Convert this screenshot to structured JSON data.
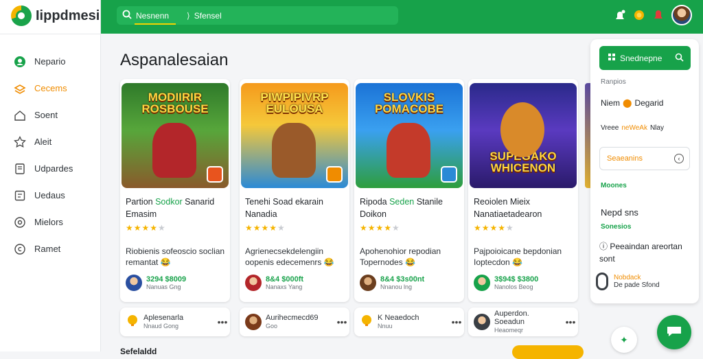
{
  "app": {
    "name": "Iippdmesi"
  },
  "sidebar": {
    "items": [
      {
        "label": "Nepario",
        "icon": "profile-icon"
      },
      {
        "label": "Cecems",
        "icon": "layers-icon",
        "active": true
      },
      {
        "label": "Soent",
        "icon": "home-icon"
      },
      {
        "label": "Aleit",
        "icon": "star-icon"
      },
      {
        "label": "Udpardes",
        "icon": "folder-icon"
      },
      {
        "label": "Uedaus",
        "icon": "list-icon"
      },
      {
        "label": "Mielors",
        "icon": "settings-icon"
      },
      {
        "label": "Ramet",
        "icon": "copyright-icon"
      }
    ]
  },
  "search": {
    "query": "Nesnenn",
    "secondary": "Sfensel"
  },
  "main": {
    "title": "Aspanalesaian"
  },
  "cards": [
    {
      "thumb_title": "MODIIRIR ROSBOUSE",
      "title_a": "Partion ",
      "title_hl": "Sodkor",
      "title_b": " Sanarid Emasim",
      "rating": 4,
      "desc": "Riobienis sofeoscio soclian remantat 😂",
      "price": "3294 $8009",
      "price_sub": "Nanuas Gng"
    },
    {
      "thumb_title": "PIWPIPIVRP EULOUSA",
      "title_a": "Tenehi Soad ekarain Nanadia",
      "title_hl": "",
      "title_b": "",
      "rating": 4,
      "desc": "Agrienecsekdelengiin oopenis edecemenrs 😂",
      "price": "8&4 $000ft",
      "price_sub": "Nanaxs Yang"
    },
    {
      "thumb_title": "SLOVKIS POMACOBE",
      "title_a": "Ripoda ",
      "title_hl": "Seden",
      "title_b": " Stanile Doikon",
      "rating": 4,
      "desc": "Apohenohior repodian Topernodes 😂",
      "price": "8&4 $3s00nt",
      "price_sub": "Nnanou lng"
    },
    {
      "thumb_title": "SUPEGAKO WHICENON",
      "title_a": "Reoiolen Mieix Nanatiaetadearon",
      "title_hl": "",
      "title_b": "",
      "rating": 4,
      "desc": "Pajpoioicane bepdonian Ioptecdon 😂",
      "price": "3$94$ $3800",
      "price_sub": "Nanolos Beog"
    }
  ],
  "bottom_row": [
    {
      "label": "Aplesenarla",
      "sub": "Nnaud Gong"
    },
    {
      "label": "Aurihecmecd69",
      "sub": "Goo"
    },
    {
      "label": "K Neaedoch",
      "sub": "Nnuu"
    },
    {
      "label": "Auperdon. Soeadun",
      "sub": "Heaomeqr"
    }
  ],
  "bottom_label": "Sefelaldd",
  "panel": {
    "button_label": "Snednepne",
    "sub1": "Ranpios",
    "line1_a": "Niem",
    "line1_b": "Degarid",
    "line2_a": "Vreee",
    "line2_hl": "neWeAk",
    "line2_b": "Nlay",
    "select_value": "Seaeanins",
    "green1": "Moones",
    "title2": "Nepd sns",
    "green2": "Sonesios",
    "text": "Peeaindan areortan sont",
    "foot1": "Nobdack",
    "foot2": "De pade Sfond"
  },
  "colors": {
    "brand": "#17a24a",
    "accent": "#f08c00",
    "star": "#f5b400"
  }
}
